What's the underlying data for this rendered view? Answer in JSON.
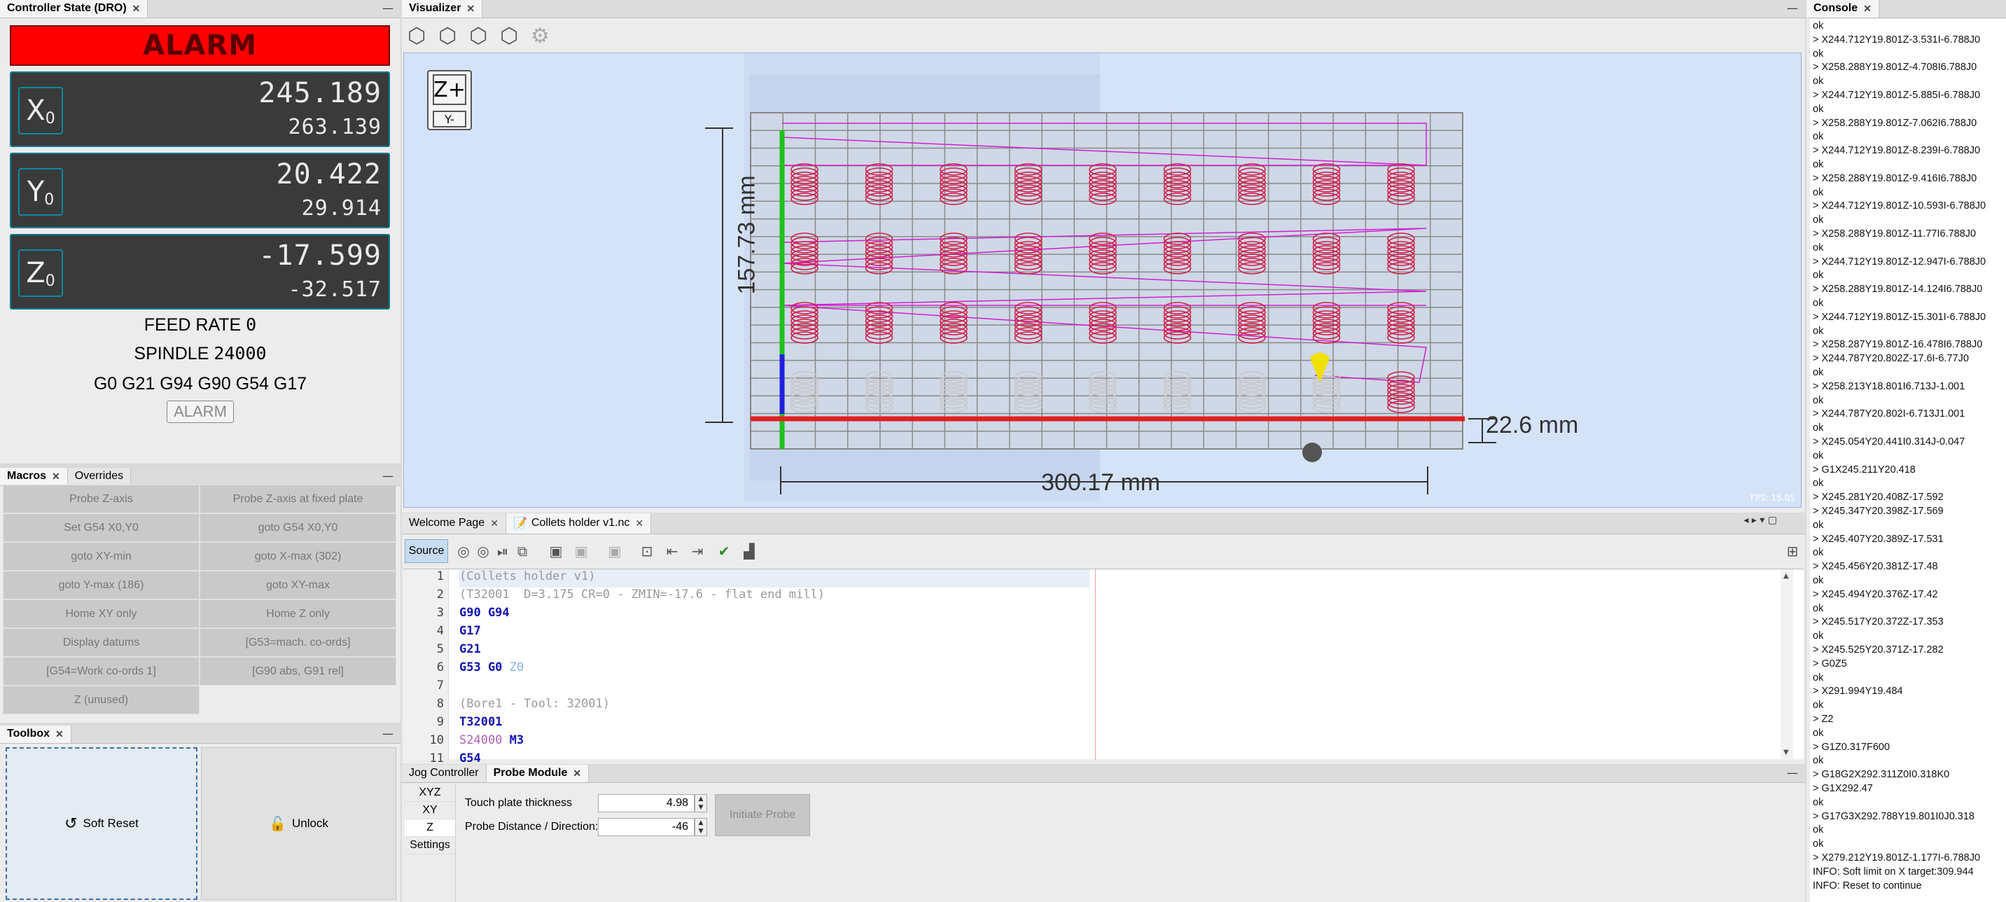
{
  "dro": {
    "title": "Controller State (DRO)",
    "state": "ALARM",
    "axes": [
      {
        "letter": "X",
        "sub": "0",
        "work": "245.189",
        "machine": "263.139"
      },
      {
        "letter": "Y",
        "sub": "0",
        "work": "20.422",
        "machine": "29.914"
      },
      {
        "letter": "Z",
        "sub": "0",
        "work": "-17.599",
        "machine": "-32.517"
      }
    ],
    "feed_label": "FEED RATE",
    "feed_value": "0",
    "spindle_label": "SPINDLE",
    "spindle_value": "24000",
    "gcode_state": "G0 G21 G94 G90 G54 G17",
    "alarm_button": "ALARM"
  },
  "macros_panel": {
    "tabs": [
      "Macros",
      "Overrides"
    ],
    "buttons": [
      "Probe Z-axis",
      "Probe Z-axis at fixed plate",
      "Set G54 X0,Y0",
      "goto G54 X0,Y0",
      "goto XY-min",
      "goto X-max (302)",
      "goto Y-max (186)",
      "goto XY-max",
      "Home XY only",
      "Home Z only",
      "Display datums",
      "[G53=mach. co-ords]",
      "[G54=Work co-ords 1]",
      "[G90 abs, G91 rel]",
      "Z (unused)"
    ]
  },
  "toolbox": {
    "title": "Toolbox",
    "soft_reset": "Soft Reset",
    "unlock": "Unlock"
  },
  "visualizer": {
    "title": "Visualizer",
    "zoom_plus": "Z+",
    "y_minus": "Y-",
    "dim_height": "157.73 mm",
    "dim_width": "300.17 mm",
    "dim_depth": "22.6 mm",
    "fps": "FPS: 15.05"
  },
  "editor_tabs": {
    "welcome": "Welcome Page",
    "file": "Collets holder v1.nc",
    "source": "Source"
  },
  "code_lines": [
    {
      "n": "1",
      "t": "(Collets holder v1)"
    },
    {
      "n": "2",
      "t": "(T32001  D=3.175 CR=0 - ZMIN=-17.6 - flat end mill)"
    },
    {
      "n": "3",
      "t": "G90 G94"
    },
    {
      "n": "4",
      "t": "G17"
    },
    {
      "n": "5",
      "t": "G21"
    },
    {
      "n": "6",
      "a": "G53 G0 ",
      "b": "Z0"
    },
    {
      "n": "7",
      "t": ""
    },
    {
      "n": "8",
      "t": "(Bore1 - Tool: 32001)"
    },
    {
      "n": "9",
      "t": "T32001"
    },
    {
      "n": "10",
      "a": "S24000",
      "b": " M3"
    },
    {
      "n": "11",
      "t": "G54"
    }
  ],
  "jog": {
    "tabs": [
      "Jog Controller",
      "Probe Module"
    ],
    "modes": [
      "XYZ",
      "XY",
      "Z",
      "Settings"
    ],
    "thickness_label": "Touch plate thickness",
    "thickness_value": "4.98",
    "distance_label": "Probe Distance / Direction:",
    "distance_value": "-46",
    "initiate": "Initiate Probe"
  },
  "console": {
    "title": "Console",
    "lines": [
      "ok",
      "> X244.712Y19.801Z-3.531I-6.788J0",
      "ok",
      "> X258.288Y19.801Z-4.708I6.788J0",
      "ok",
      "> X244.712Y19.801Z-5.885I-6.788J0",
      "ok",
      "> X258.288Y19.801Z-7.062I6.788J0",
      "ok",
      "> X244.712Y19.801Z-8.239I-6.788J0",
      "ok",
      "> X258.288Y19.801Z-9.416I6.788J0",
      "ok",
      "> X244.712Y19.801Z-10.593I-6.788J0",
      "ok",
      "> X258.288Y19.801Z-11.77I6.788J0",
      "ok",
      "> X244.712Y19.801Z-12.947I-6.788J0",
      "ok",
      "> X258.288Y19.801Z-14.124I6.788J0",
      "ok",
      "> X244.712Y19.801Z-15.301I-6.788J0",
      "ok",
      "> X258.287Y19.801Z-16.478I6.788J0",
      "> X244.787Y20.802Z-17.6I-6.77J0",
      "ok",
      "> X258.213Y18.801I6.713J-1.001",
      "ok",
      "> X244.787Y20.802I-6.713J1.001",
      "ok",
      "> X245.054Y20.441I0.314J-0.047",
      "ok",
      "> G1X245.211Y20.418",
      "ok",
      "> X245.281Y20.408Z-17.592",
      "> X245.347Y20.398Z-17.569",
      "ok",
      "> X245.407Y20.389Z-17.531",
      "ok",
      "> X245.456Y20.381Z-17.48",
      "ok",
      "> X245.494Y20.376Z-17.42",
      "ok",
      "> X245.517Y20.372Z-17.353",
      "ok",
      "> X245.525Y20.371Z-17.282",
      "> G0Z5",
      "ok",
      "> X291.994Y19.484",
      "ok",
      "> Z2",
      "ok",
      "> G1Z0.317F600",
      "ok",
      "> G18G2X292.311Z0I0.318K0",
      "> G1X292.47",
      "ok",
      "> G17G3X292.788Y19.801I0J0.318",
      "ok",
      "ok",
      "> X279.212Y19.801Z-1.177I-6.788J0",
      "INFO: Soft limit on X target:309.944",
      "INFO: Reset to continue"
    ]
  }
}
